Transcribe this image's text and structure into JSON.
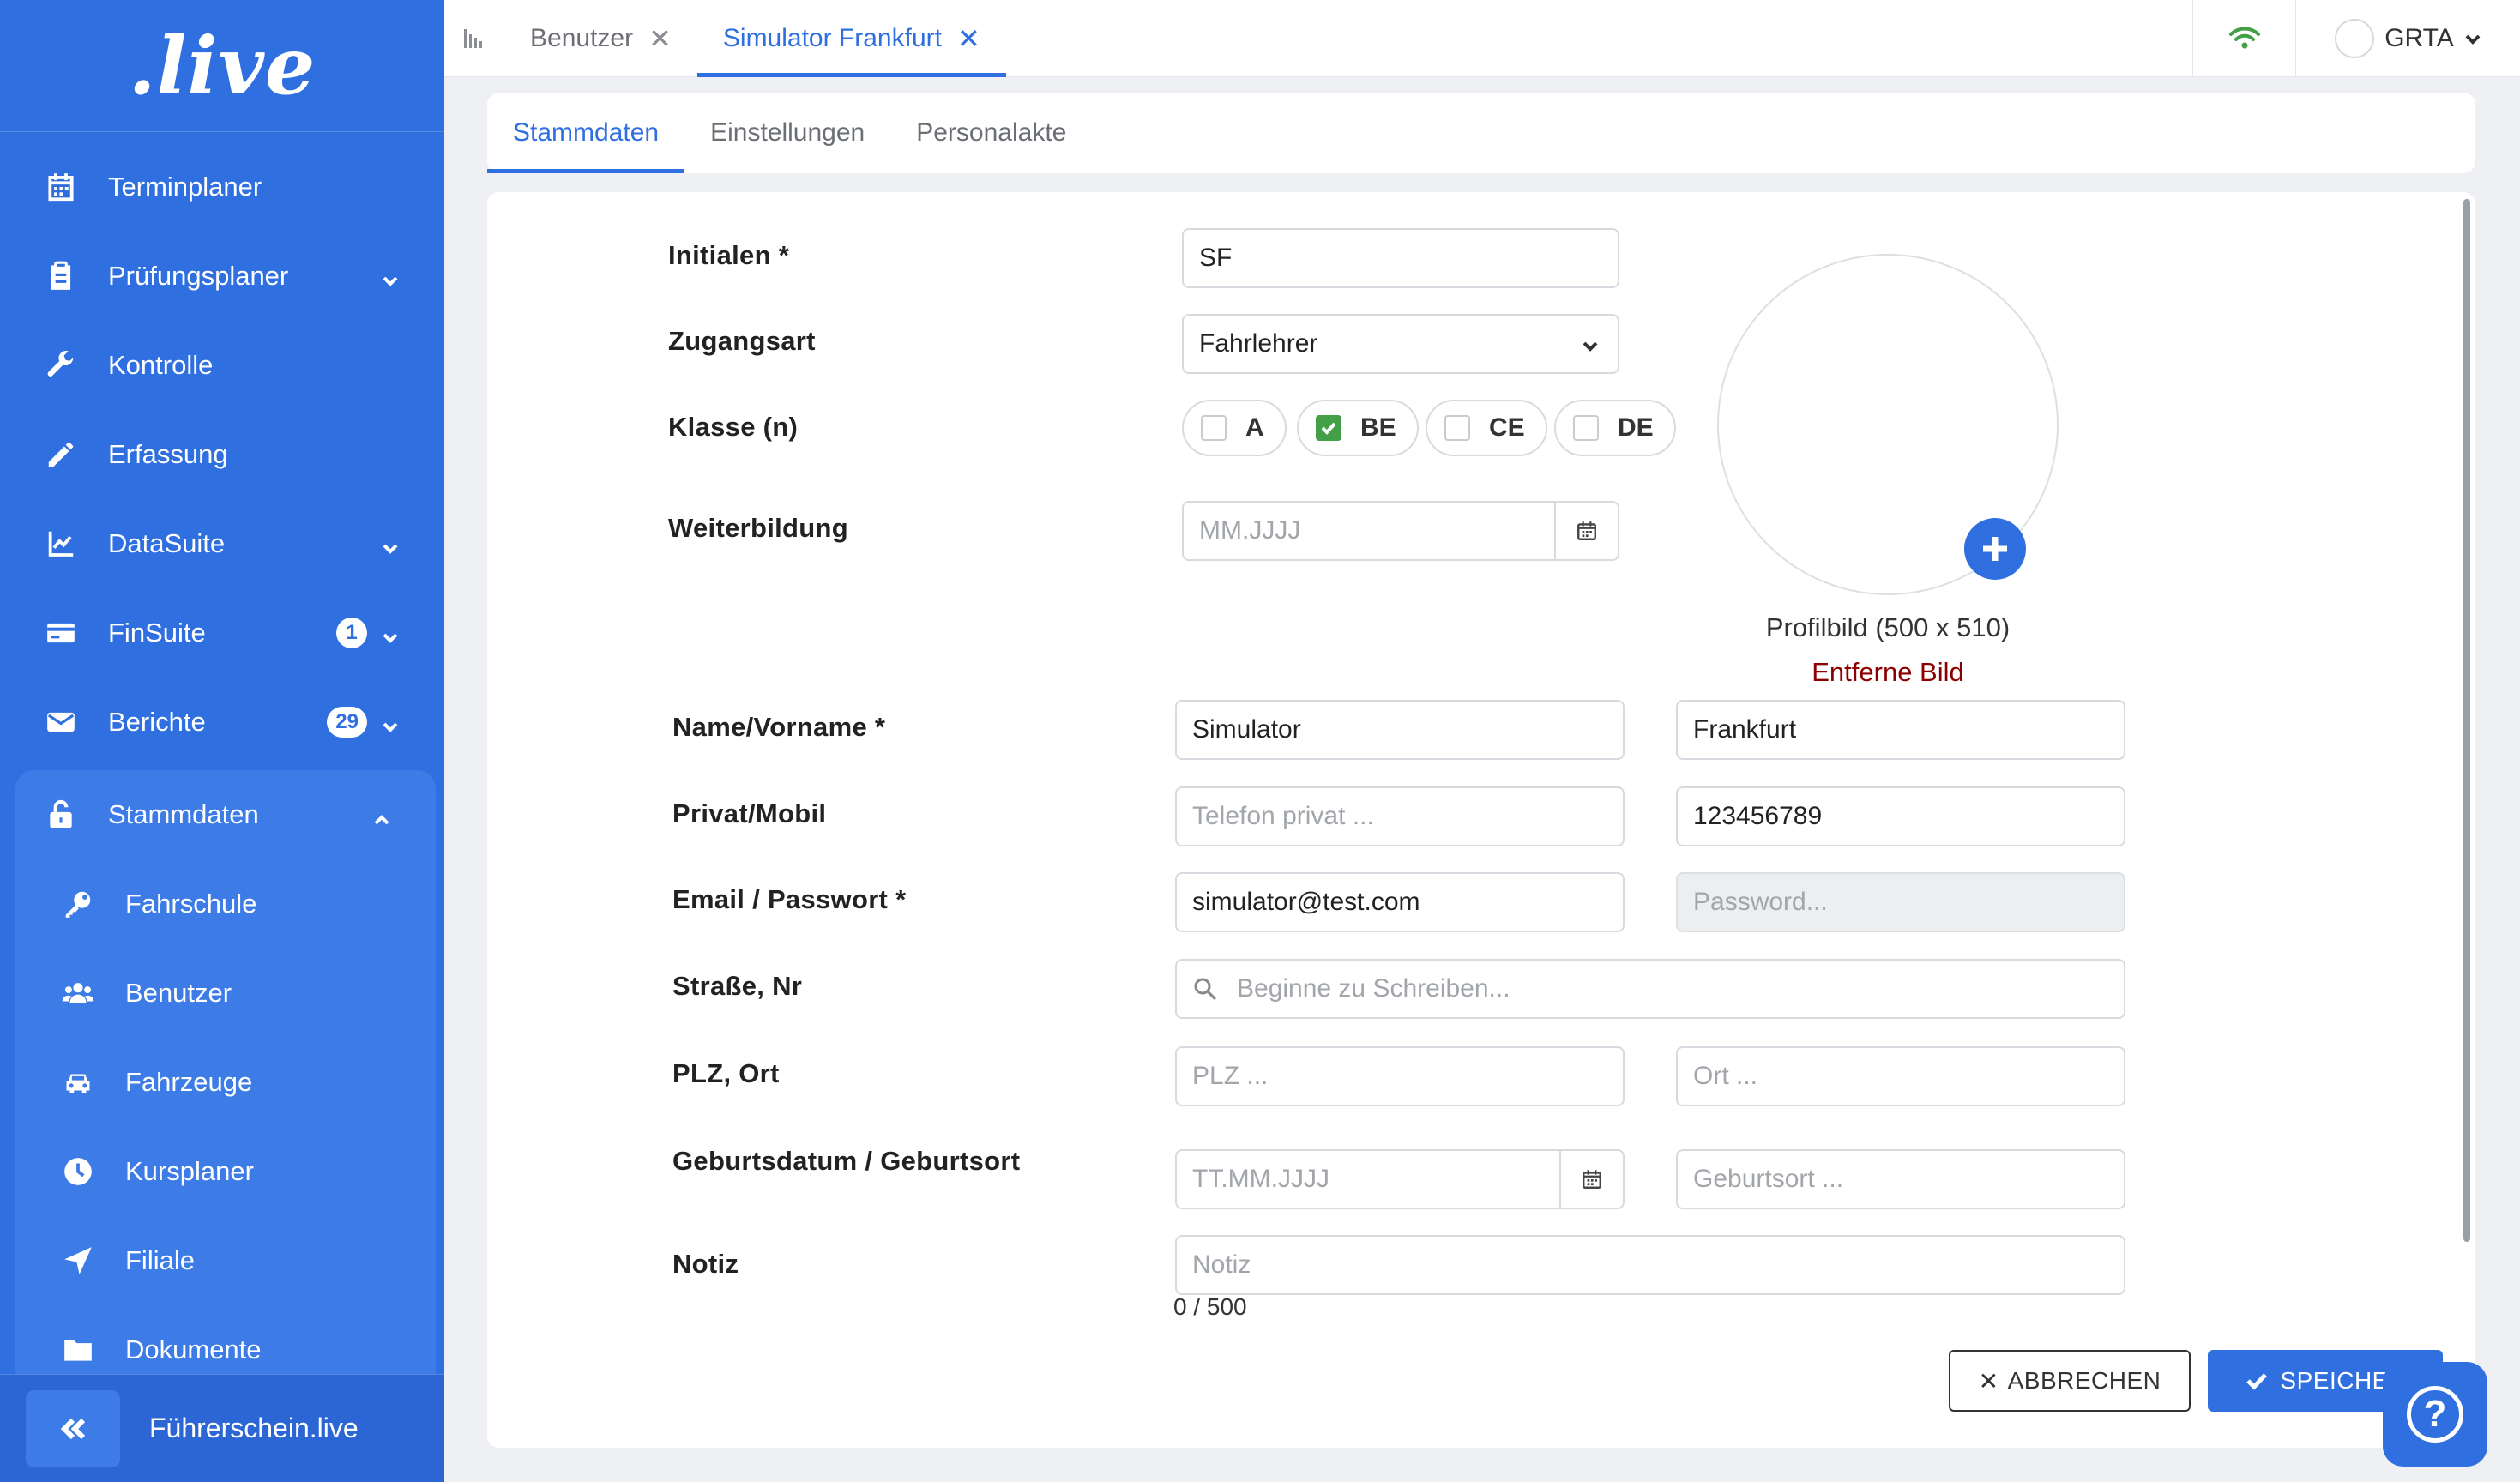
{
  "brand": {
    "logo_text": ".live",
    "accent": "#2f6fe0",
    "footer_label": "Führerschein.live"
  },
  "sidebar": {
    "items": [
      {
        "label": "Terminplaner",
        "icon": "calendar-icon"
      },
      {
        "label": "Prüfungsplaner",
        "icon": "clipboard-icon",
        "chevron": "down"
      },
      {
        "label": "Kontrolle",
        "icon": "wrench-icon"
      },
      {
        "label": "Erfassung",
        "icon": "pencil-icon"
      },
      {
        "label": "DataSuite",
        "icon": "chart-line-icon",
        "chevron": "down"
      },
      {
        "label": "FinSuite",
        "icon": "credit-card-icon",
        "badge": "1",
        "chevron": "down"
      },
      {
        "label": "Berichte",
        "icon": "envelope-icon",
        "badge": "29",
        "chevron": "down"
      }
    ],
    "group": {
      "label": "Stammdaten",
      "icon": "unlock-icon",
      "chevron": "up",
      "children": [
        {
          "label": "Fahrschule",
          "icon": "key-icon"
        },
        {
          "label": "Benutzer",
          "icon": "users-icon"
        },
        {
          "label": "Fahrzeuge",
          "icon": "car-icon"
        },
        {
          "label": "Kursplaner",
          "icon": "clock-icon"
        },
        {
          "label": "Filiale",
          "icon": "location-arrow-icon"
        },
        {
          "label": "Dokumente",
          "icon": "folder-icon"
        }
      ]
    }
  },
  "topbar": {
    "tabs": [
      {
        "label": "Benutzer",
        "active": false
      },
      {
        "label": "Simulator Frankfurt",
        "active": true
      }
    ],
    "user_name": "GRTA",
    "status_color": "#43a047"
  },
  "subtabs": [
    {
      "label": "Stammdaten",
      "active": true
    },
    {
      "label": "Einstellungen",
      "active": false
    },
    {
      "label": "Personalakte",
      "active": false
    }
  ],
  "form": {
    "initialen": {
      "label": "Initialen *",
      "value": "SF"
    },
    "zugangsart": {
      "label": "Zugangsart",
      "value": "Fahrlehrer"
    },
    "klasse": {
      "label": "Klasse (n)",
      "options": [
        {
          "label": "A",
          "checked": false
        },
        {
          "label": "BE",
          "checked": true
        },
        {
          "label": "CE",
          "checked": false
        },
        {
          "label": "DE",
          "checked": false
        }
      ]
    },
    "weiterbildung": {
      "label": "Weiterbildung",
      "placeholder": "MM.JJJJ"
    },
    "profilbild": {
      "label": "Profilbild (500 x 510)",
      "remove": "Entferne Bild"
    },
    "name": {
      "label": "Name/Vorname *",
      "last": "Simulator",
      "first": "Frankfurt"
    },
    "phone": {
      "label": "Privat/Mobil",
      "private_placeholder": "Telefon privat ...",
      "mobile": "123456789"
    },
    "email": {
      "label": "Email / Passwort *",
      "value": "simulator@test.com",
      "password_placeholder": "Password..."
    },
    "strasse": {
      "label": "Straße, Nr",
      "placeholder": "Beginne zu Schreiben..."
    },
    "plz": {
      "label": "PLZ, Ort",
      "plz_placeholder": "PLZ ...",
      "ort_placeholder": "Ort ..."
    },
    "geburt": {
      "label": "Geburtsdatum / Geburtsort",
      "date_placeholder": "TT.MM.JJJJ",
      "place_placeholder": "Geburtsort ..."
    },
    "notiz": {
      "label": "Notiz",
      "placeholder": "Notiz",
      "counter": "0 / 500"
    }
  },
  "actions": {
    "cancel": "ABBRECHEN",
    "save": "SPEICHER"
  },
  "help": {
    "glyph": "?"
  }
}
